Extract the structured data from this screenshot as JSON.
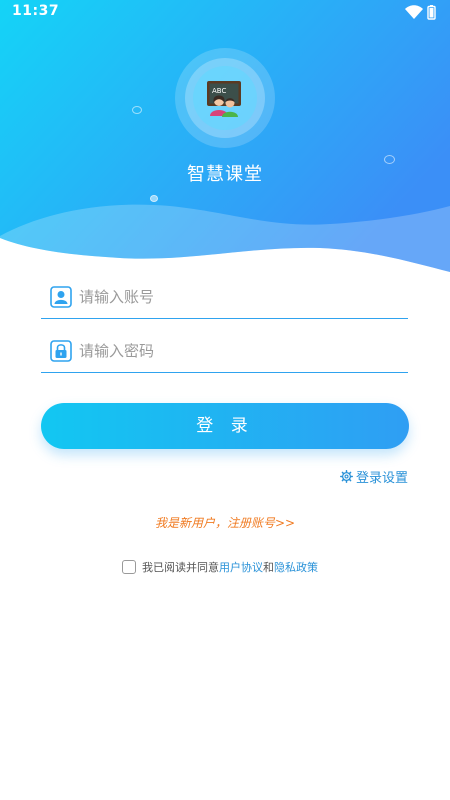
{
  "status_bar": {
    "time": "11:37",
    "wifi_icon": "wifi-icon",
    "battery_icon": "battery-icon"
  },
  "header": {
    "app_title": "智慧课堂",
    "logo_icon": "classroom-logo-icon",
    "logo_board_text": "ABC"
  },
  "form": {
    "account": {
      "placeholder": "请输入账号",
      "value": "",
      "icon": "user-icon"
    },
    "password": {
      "placeholder": "请输入密码",
      "value": "",
      "icon": "lock-icon"
    },
    "login_label": "登 录",
    "settings_label": "登录设置",
    "settings_icon": "gear-icon",
    "register_label": "我是新用户，注册账号>>"
  },
  "agreement": {
    "prefix": "我已阅读并同意",
    "user_agreement": "用户协议",
    "conjunction": "和",
    "privacy_policy": "隐私政策",
    "checked": false
  },
  "colors": {
    "gradient_start": "#14d3f6",
    "gradient_end": "#3b93f7",
    "accent": "#2fa3ef",
    "link": "#2a92d8",
    "register": "#f07b22"
  }
}
